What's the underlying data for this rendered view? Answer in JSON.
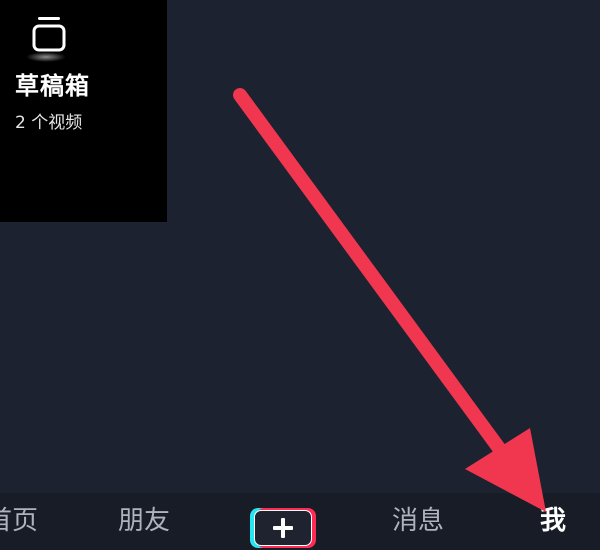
{
  "drafts": {
    "title": "草稿箱",
    "count": "2 个视频",
    "icon": "drafts-box-icon"
  },
  "nav": {
    "home": "首页",
    "friends": "朋友",
    "create_icon": "plus-icon",
    "messages": "消息",
    "me": "我"
  },
  "colors": {
    "background": "#1c2230",
    "nav_bar": "#171c26",
    "arrow": "#f0374f",
    "create_cyan": "#25e6f0",
    "create_pink": "#fe2c55"
  }
}
